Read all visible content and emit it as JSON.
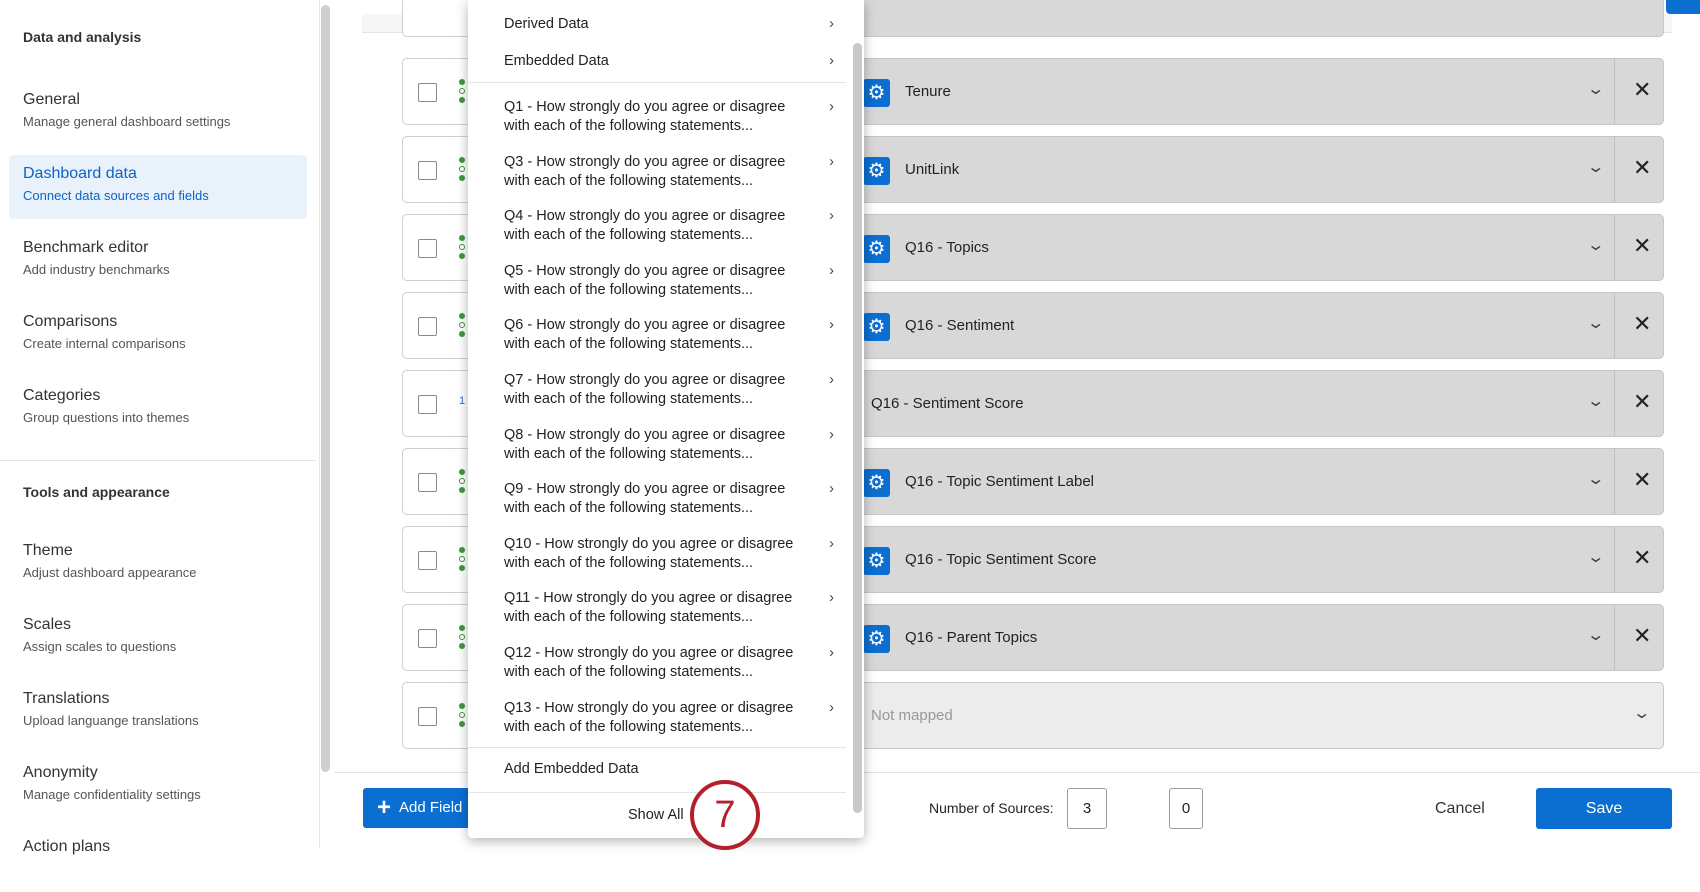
{
  "sidebar": {
    "section1": "Data and analysis",
    "section2": "Tools and appearance",
    "items": [
      {
        "title": "General",
        "sub": "Manage general dashboard settings"
      },
      {
        "title": "Dashboard data",
        "sub": "Connect data sources and fields"
      },
      {
        "title": "Benchmark editor",
        "sub": "Add industry benchmarks"
      },
      {
        "title": "Comparisons",
        "sub": "Create internal comparisons"
      },
      {
        "title": "Categories",
        "sub": "Group questions into themes"
      },
      {
        "title": "Theme",
        "sub": "Adjust dashboard appearance"
      },
      {
        "title": "Scales",
        "sub": "Assign scales to questions"
      },
      {
        "title": "Translations",
        "sub": "Upload languange translations"
      },
      {
        "title": "Anonymity",
        "sub": "Manage confidentiality settings"
      },
      {
        "title": "Action plans",
        "sub": ""
      }
    ]
  },
  "rows": [
    {
      "left_icon": "dots",
      "label": "Tenure",
      "gear": true
    },
    {
      "left_icon": "dots",
      "label": "UnitLink",
      "gear": true
    },
    {
      "left_icon": "dots",
      "label": "Q16 - Topics",
      "gear": true
    },
    {
      "left_icon": "dots",
      "label": "Q16 - Sentiment",
      "gear": true
    },
    {
      "left_icon": "number",
      "number": "1",
      "label": "Q16 - Sentiment Score",
      "gear": false
    },
    {
      "left_icon": "dots",
      "label": "Q16 - Topic Sentiment Label",
      "gear": true
    },
    {
      "left_icon": "dots",
      "label": "Q16 - Topic Sentiment Score",
      "gear": true
    },
    {
      "left_icon": "dots",
      "label": "Q16 - Parent Topics",
      "gear": true
    },
    {
      "left_icon": "dots",
      "label": "Not mapped",
      "gear": false,
      "placeholder": true
    }
  ],
  "dropdown": {
    "top_items": [
      "Derived Data",
      "Embedded Data"
    ],
    "questions": [
      "Q1 - How strongly do you agree or disagree with each of the following statements...",
      "Q3 - How strongly do you agree or disagree with each of the following statements...",
      "Q4 - How strongly do you agree or disagree with each of the following statements...",
      "Q5 - How strongly do you agree or disagree with each of the following statements...",
      "Q6 - How strongly do you agree or disagree with each of the following statements...",
      "Q7 - How strongly do you agree or disagree with each of the following statements...",
      "Q8 - How strongly do you agree or disagree with each of the following statements...",
      "Q9 - How strongly do you agree or disagree with each of the following statements...",
      "Q10 - How strongly do you agree or disagree with each of the following statements...",
      "Q11 - How strongly do you agree or disagree with each of the following statements...",
      "Q12 - How strongly do you agree or disagree with each of the following statements...",
      "Q13 - How strongly do you agree or disagree with each of the following statements..."
    ],
    "add_embedded": "Add Embedded Data",
    "show_all": "Show All"
  },
  "footer": {
    "add_field": "Add Field",
    "count_value": "0",
    "sources_label": "Number of Sources:",
    "sources_value": "3",
    "cancel": "Cancel",
    "save": "Save"
  },
  "step_marker": "7",
  "colors": {
    "accent": "#0b6fd2",
    "marker": "#b3202b"
  }
}
